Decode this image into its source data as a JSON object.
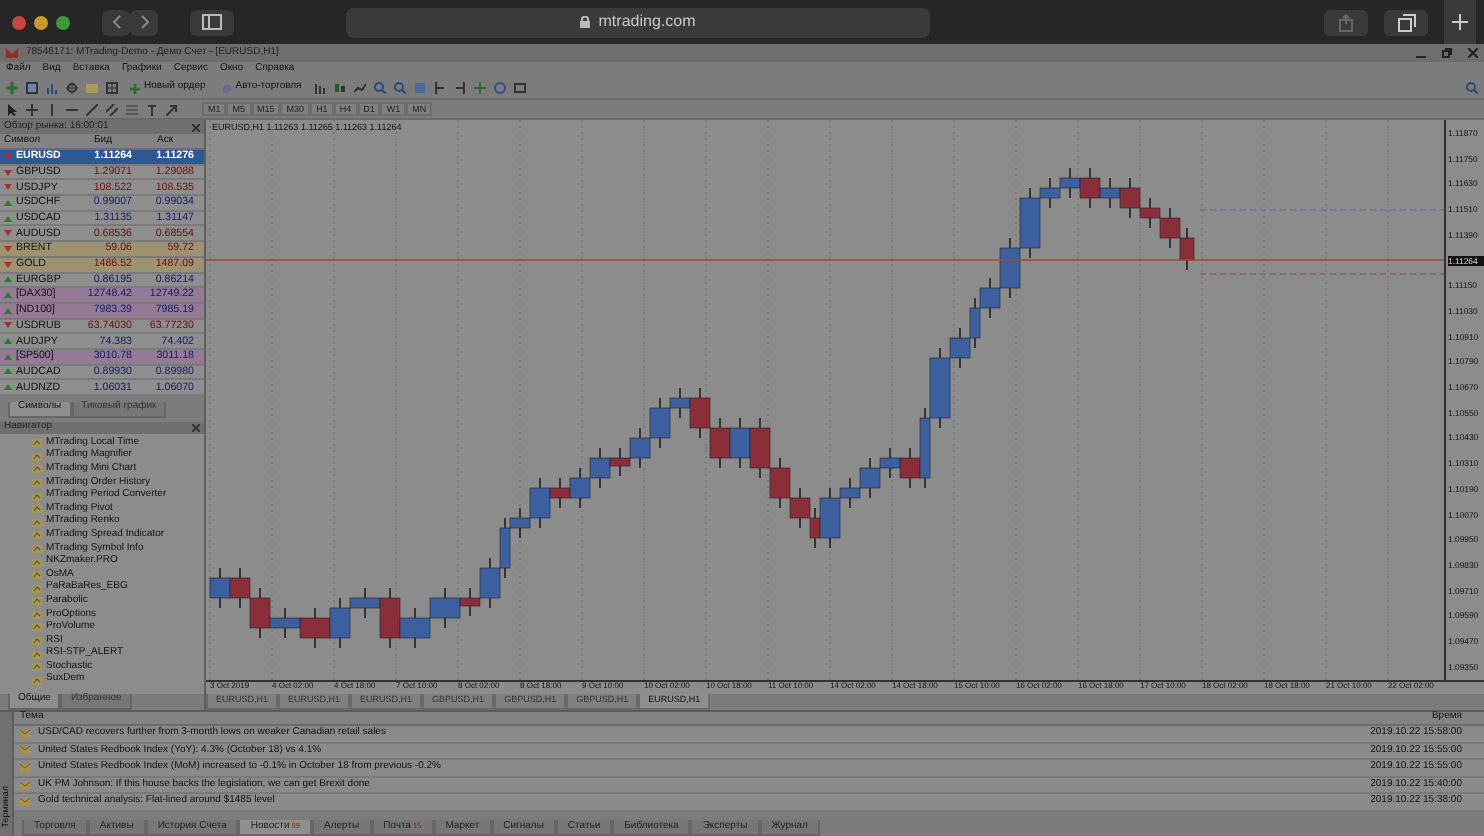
{
  "browser": {
    "url": "mtrading.com"
  },
  "window": {
    "title": "78546171: MTrading-Demo - Демо Счет - [EURUSD,H1]"
  },
  "menu": [
    "Файл",
    "Вид",
    "Вставка",
    "Графики",
    "Сервис",
    "Окно",
    "Справка"
  ],
  "toolbar": {
    "buttons": [
      "Новый ордер",
      "Авто-торговля"
    ],
    "timeframes": [
      "M1",
      "M5",
      "M15",
      "M30",
      "H1",
      "H4",
      "D1",
      "W1",
      "MN"
    ]
  },
  "market_watch": {
    "title": "Обзор рынка: 16:00:01",
    "columns": [
      "Символ",
      "Бид",
      "Аск"
    ],
    "rows": [
      {
        "symbol": "EURUSD",
        "bid": "1.11264",
        "ask": "1.11276",
        "rising": false,
        "color": "#2d5896",
        "selected": true
      },
      {
        "symbol": "GBPUSD",
        "bid": "1.29071",
        "ask": "1.29088",
        "rising": false,
        "color": "#8e8e8e",
        "selected": false
      },
      {
        "symbol": "USDJPY",
        "bid": "108.522",
        "ask": "108.535",
        "rising": false,
        "color": "#8e8e8e",
        "selected": false
      },
      {
        "symbol": "USDCHF",
        "bid": "0.99007",
        "ask": "0.99034",
        "rising": true,
        "color": "#8e8e8e",
        "selected": false
      },
      {
        "symbol": "USDCAD",
        "bid": "1.31135",
        "ask": "1.31147",
        "rising": true,
        "color": "#8e8e8e",
        "selected": false
      },
      {
        "symbol": "AUDUSD",
        "bid": "0.68536",
        "ask": "0.68554",
        "rising": false,
        "color": "#8e8e8e",
        "selected": false
      },
      {
        "symbol": "BRENT",
        "bid": "59.06",
        "ask": "59.72",
        "rising": false,
        "color": "#9c9270",
        "selected": false
      },
      {
        "symbol": "GOLD",
        "bid": "1486.52",
        "ask": "1487.09",
        "rising": false,
        "color": "#9c9270",
        "selected": false
      },
      {
        "symbol": "EURGBP",
        "bid": "0.86195",
        "ask": "0.86214",
        "rising": true,
        "color": "#8e8e8e",
        "selected": false
      },
      {
        "symbol": "[DAX30]",
        "bid": "12748.42",
        "ask": "12749.22",
        "rising": true,
        "color": "#957a95",
        "selected": false
      },
      {
        "symbol": "[ND100]",
        "bid": "7983.39",
        "ask": "7985.19",
        "rising": true,
        "color": "#957a95",
        "selected": false
      },
      {
        "symbol": "USDRUB",
        "bid": "63.74030",
        "ask": "63.77230",
        "rising": false,
        "color": "#8e8e8e",
        "selected": false
      },
      {
        "symbol": "AUDJPY",
        "bid": "74.383",
        "ask": "74.402",
        "rising": true,
        "color": "#8e8e8e",
        "selected": false
      },
      {
        "symbol": "[SP500]",
        "bid": "3010.78",
        "ask": "3011.18",
        "rising": true,
        "color": "#957a95",
        "selected": false
      },
      {
        "symbol": "AUDCAD",
        "bid": "0.89930",
        "ask": "0.89980",
        "rising": true,
        "color": "#8e8e8e",
        "selected": false
      },
      {
        "symbol": "AUDNZD",
        "bid": "1.06031",
        "ask": "1.06070",
        "rising": true,
        "color": "#8e8e8e",
        "selected": false
      }
    ],
    "tabs": [
      {
        "label": "Символы",
        "selected": true
      },
      {
        "label": "Тиковый график",
        "selected": false
      }
    ]
  },
  "navigator": {
    "title": "Навигатор",
    "items": [
      "MTrading Local Time",
      "MTrading Magnifier",
      "MTrading Mini Chart",
      "MTrading Order History",
      "MTrading Period Converter",
      "MTrading Pivot",
      "MTrading Renko",
      "MTrading Spread Indicator",
      "MTrading Symbol Info",
      "NKZmaker.PRO",
      "OsMA",
      "PaRaBaRes_EBG",
      "Parabolic",
      "ProOptions",
      "ProVolume",
      "RSI",
      "RSI-STP_ALERT",
      "Stochastic",
      "SuxDem"
    ],
    "tabs": [
      {
        "label": "Общие",
        "selected": true
      },
      {
        "label": "Избранное",
        "selected": false
      }
    ]
  },
  "chart": {
    "title": "EURUSD,H1  1.11263 1.11265 1.11263 1.11264",
    "price_labels": [
      {
        "text": "1.11870",
        "kind": "tick"
      },
      {
        "text": "1.11750",
        "kind": "tick"
      },
      {
        "text": "1.11630",
        "kind": "tick"
      },
      {
        "text": "1.11510",
        "kind": "tick"
      },
      {
        "text": "1.11390",
        "kind": "tick"
      },
      {
        "text": "1.11264",
        "kind": "current"
      },
      {
        "text": "1.11150",
        "kind": "tick"
      },
      {
        "text": "1.11030",
        "kind": "tick"
      },
      {
        "text": "1.10910",
        "kind": "tick"
      },
      {
        "text": "1.10790",
        "kind": "tick"
      },
      {
        "text": "1.10670",
        "kind": "tick"
      },
      {
        "text": "1.10550",
        "kind": "tick"
      },
      {
        "text": "1.10430",
        "kind": "tick"
      },
      {
        "text": "1.10310",
        "kind": "tick"
      },
      {
        "text": "1.10190",
        "kind": "tick"
      },
      {
        "text": "1.10070",
        "kind": "tick"
      },
      {
        "text": "1.09950",
        "kind": "tick"
      },
      {
        "text": "1.09830",
        "kind": "tick"
      },
      {
        "text": "1.09710",
        "kind": "tick"
      },
      {
        "text": "1.09590",
        "kind": "tick"
      },
      {
        "text": "1.09470",
        "kind": "tick"
      },
      {
        "text": "1.09350",
        "kind": "tick"
      }
    ],
    "time_labels": [
      "3 Oct 2019",
      "4 Oct 02:00",
      "4 Oct 18:00",
      "7 Oct 10:00",
      "8 Oct 02:00",
      "8 Oct 18:00",
      "9 Oct 10:00",
      "10 Oct 02:00",
      "10 Oct 18:00",
      "11 Oct 10:00",
      "14 Oct 02:00",
      "14 Oct 18:00",
      "15 Oct 10:00",
      "16 Oct 02:00",
      "16 Oct 18:00",
      "17 Oct 10:00",
      "18 Oct 02:00",
      "18 Oct 18:00",
      "21 Oct 10:00",
      "22 Oct 02:00"
    ],
    "tabs": [
      {
        "label": "EURUSD,H1",
        "selected": false
      },
      {
        "label": "EURUSD,H1",
        "selected": false
      },
      {
        "label": "EURUSD,H1",
        "selected": false
      },
      {
        "label": "GBPUSD,H1",
        "selected": false
      },
      {
        "label": "GBPUSD,H1",
        "selected": false
      },
      {
        "label": "GBPUSD,H1",
        "selected": false
      },
      {
        "label": "EURUSD,H1",
        "selected": true
      }
    ]
  },
  "terminal": {
    "side_label": "Терминал",
    "columns": [
      "Тема",
      "Время"
    ],
    "rows": [
      {
        "title": "USD/CAD recovers further from 3-month lows on weaker Canadian retail sales",
        "time": "2019.10.22 15:58:00"
      },
      {
        "title": "United States Redbook Index (YoY): 4.3% (October 18) vs 4.1%",
        "time": "2019.10.22 15:55:00"
      },
      {
        "title": "United States Redbook Index (MoM) increased to -0.1% in October 18 from previous -0.2%",
        "time": "2019.10.22 15:55:00"
      },
      {
        "title": "UK PM Johnson: If this house backs the legislation, we can get Brexit done",
        "time": "2019.10.22 15:40:00"
      },
      {
        "title": "Gold technical analysis: Flat-lined around $1485 level",
        "time": "2019.10.22 15:38:00"
      }
    ],
    "tabs": [
      {
        "label": "Торговля",
        "selected": false
      },
      {
        "label": "Активы",
        "selected": false
      },
      {
        "label": "История Счета",
        "selected": false
      },
      {
        "label": "Новости",
        "badge": "99",
        "selected": true
      },
      {
        "label": "Алерты",
        "selected": false
      },
      {
        "label": "Почта",
        "badge": "15",
        "selected": false
      },
      {
        "label": "Маркет",
        "selected": false
      },
      {
        "label": "Сигналы",
        "selected": false
      },
      {
        "label": "Статьи",
        "selected": false
      },
      {
        "label": "Библиотека",
        "selected": false
      },
      {
        "label": "Эксперты",
        "selected": false
      },
      {
        "label": "Журнал",
        "selected": false
      }
    ]
  }
}
